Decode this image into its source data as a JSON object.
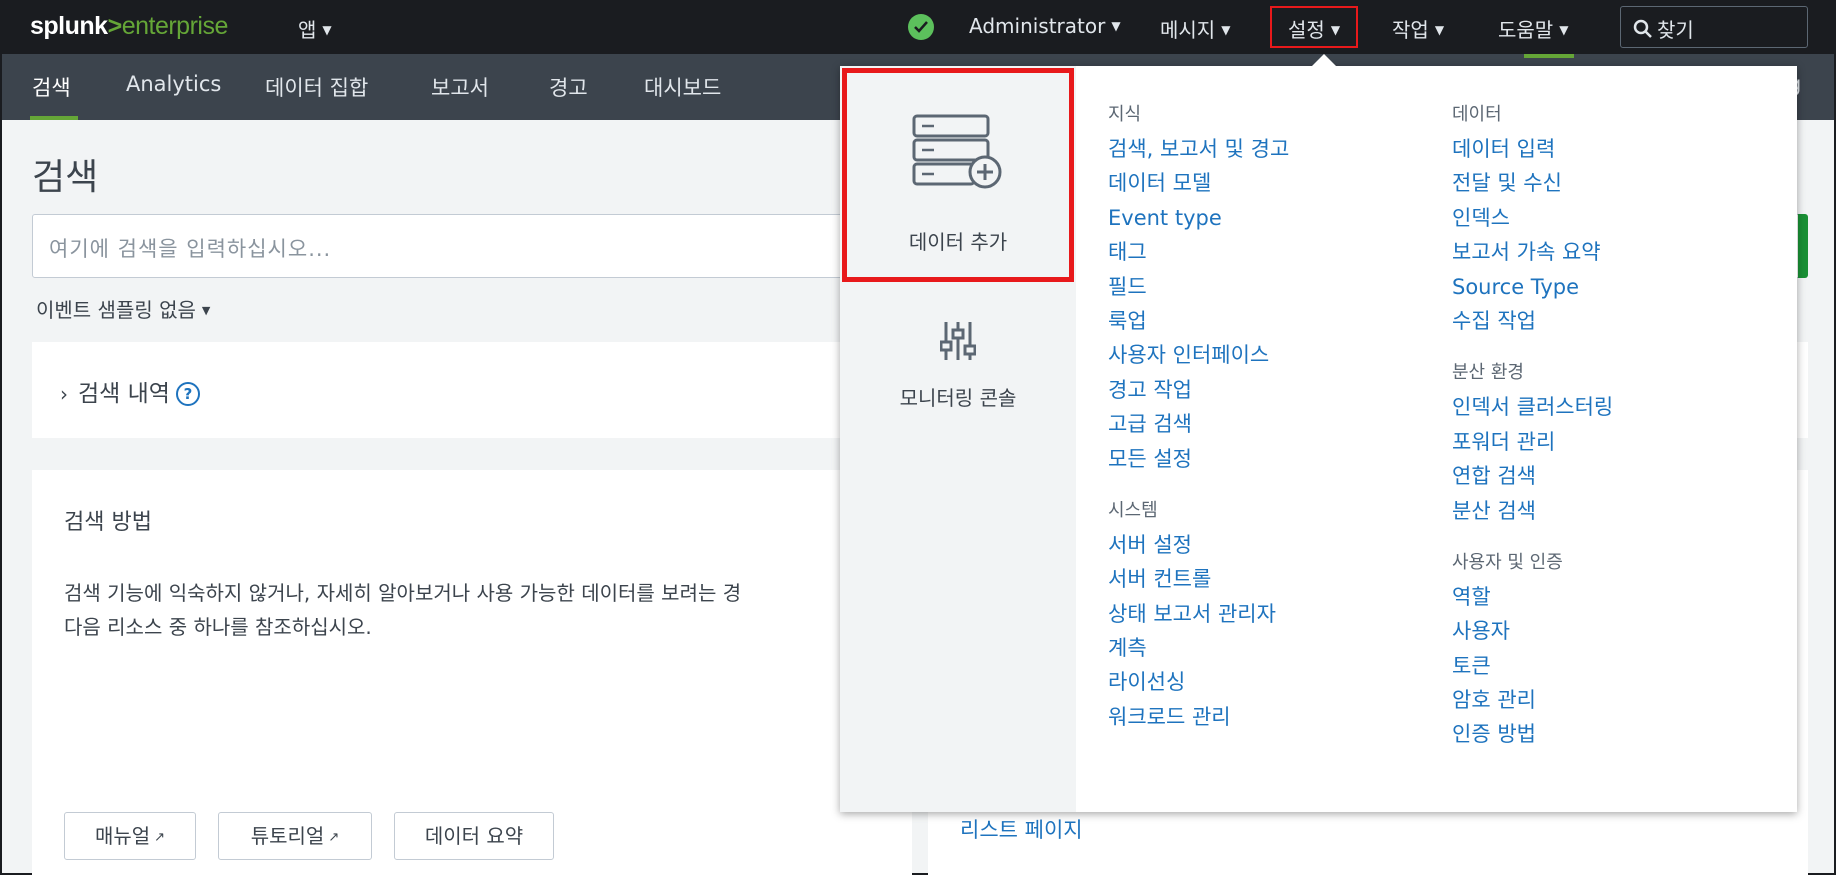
{
  "topbar": {
    "logo_splunk": "splunk",
    "logo_gt": ">",
    "logo_enterprise": "enterprise",
    "apps_label": "앱",
    "user_label": "Administrator",
    "messages_label": "메시지",
    "settings_label": "설정",
    "activity_label": "작업",
    "help_label": "도움말",
    "find_label": "찾기"
  },
  "nav": {
    "items": [
      "검색",
      "Analytics",
      "데이터 집합",
      "보고서",
      "경고",
      "대시보드"
    ],
    "right_text": "g"
  },
  "page": {
    "title": "검색",
    "search_placeholder": "여기에 검색을 입력하십시오...",
    "sampling_label": "이벤트 샘플링 없음",
    "history_label": "검색 내역",
    "help_icon": "?",
    "how_title": "검색 방법",
    "how_text_line1": "검색 기능에 익숙하지 않거나, 자세히 알아보거나 사용 가능한 데이터를 보려는 경",
    "how_text_line2": "다음 리소스 중 하나를 참조하십시오.",
    "buttons": {
      "manual": "매뉴얼",
      "tutorial": "튜토리얼",
      "data_summary": "데이터 요약"
    },
    "right_link": "리스트 페이지"
  },
  "settings_menu": {
    "tiles": {
      "add_data": "데이터 추가",
      "monitoring_console": "모니터링 콘솔"
    },
    "col1": [
      {
        "heading": "지식",
        "links": [
          "검색, 보고서 및 경고",
          "데이터 모델",
          "Event type",
          "태그",
          "필드",
          "룩업",
          "사용자 인터페이스",
          "경고 작업",
          "고급 검색",
          "모든 설정"
        ]
      },
      {
        "heading": "시스템",
        "links": [
          "서버 설정",
          "서버 컨트롤",
          "상태 보고서 관리자",
          "계측",
          "라이선싱",
          "워크로드 관리"
        ]
      }
    ],
    "col2": [
      {
        "heading": "데이터",
        "links": [
          "데이터 입력",
          "전달 및 수신",
          "인덱스",
          "보고서 가속 요약",
          "Source Type",
          "수집 작업"
        ]
      },
      {
        "heading": "분산 환경",
        "links": [
          "인덱서 클러스터링",
          "포워더 관리",
          "연합 검색",
          "분산 검색"
        ]
      },
      {
        "heading": "사용자 및 인증",
        "links": [
          "역할",
          "사용자",
          "토큰",
          "암호 관리",
          "인증 방법"
        ]
      }
    ]
  },
  "colors": {
    "topbar_bg": "#1a1c20",
    "navbar_bg": "#3c444d",
    "accent_green": "#65a637",
    "link_blue": "#1e73be",
    "highlight_red": "#e8191b"
  },
  "icons": {
    "status": "check-circle-icon",
    "find": "search-icon",
    "add_data": "server-add-icon",
    "monitoring": "sliders-icon",
    "external": "external-link-icon",
    "history": "chevron-right-icon"
  }
}
